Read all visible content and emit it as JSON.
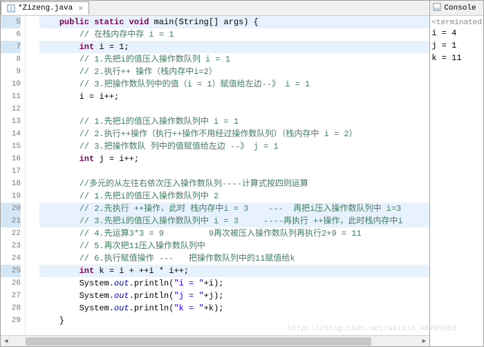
{
  "tab": {
    "title": "*Zizeng.java"
  },
  "console": {
    "label": "Console",
    "status": "<terminated",
    "lines": [
      "i = 4",
      "j = 1",
      "k = 11"
    ]
  },
  "lines": [
    {
      "n": 5,
      "hl": true,
      "segs": [
        {
          "t": "    ",
          "c": ""
        },
        {
          "t": "public static void",
          "c": "kw"
        },
        {
          "t": " main(String[] args) {",
          "c": ""
        }
      ]
    },
    {
      "n": 6,
      "segs": [
        {
          "t": "        ",
          "c": ""
        },
        {
          "t": "// 在栈内存中存 i = 1",
          "c": "cm"
        }
      ]
    },
    {
      "n": 7,
      "hl": true,
      "segs": [
        {
          "t": "        ",
          "c": ""
        },
        {
          "t": "int",
          "c": "kw"
        },
        {
          "t": " i = 1;",
          "c": ""
        }
      ]
    },
    {
      "n": 8,
      "segs": [
        {
          "t": "        ",
          "c": ""
        },
        {
          "t": "// 1.先把i的值压入操作数队列 i = 1",
          "c": "cm"
        }
      ]
    },
    {
      "n": 9,
      "segs": [
        {
          "t": "        ",
          "c": ""
        },
        {
          "t": "// 2.执行++ 操作（栈内存中i=2）",
          "c": "cm"
        }
      ]
    },
    {
      "n": 10,
      "segs": [
        {
          "t": "        ",
          "c": ""
        },
        {
          "t": "// 3.把操作数队列中的值（i = 1）赋值给左边--》 i = 1",
          "c": "cm"
        }
      ]
    },
    {
      "n": 11,
      "segs": [
        {
          "t": "        i = i++;",
          "c": ""
        }
      ]
    },
    {
      "n": 12,
      "segs": [
        {
          "t": "",
          "c": ""
        }
      ]
    },
    {
      "n": 13,
      "segs": [
        {
          "t": "        ",
          "c": ""
        },
        {
          "t": "// 1.先把i的值压入操作数队列中 i = 1",
          "c": "cm"
        }
      ]
    },
    {
      "n": 14,
      "segs": [
        {
          "t": "        ",
          "c": ""
        },
        {
          "t": "// 2.执行++操作（执行++操作不用经过操作数队列）（栈内存中 i = 2）",
          "c": "cm"
        }
      ]
    },
    {
      "n": 15,
      "segs": [
        {
          "t": "        ",
          "c": ""
        },
        {
          "t": "// 3.把操作数队 列中的值赋值给左边 --》 j = 1",
          "c": "cm"
        }
      ]
    },
    {
      "n": 16,
      "segs": [
        {
          "t": "        ",
          "c": ""
        },
        {
          "t": "int",
          "c": "kw"
        },
        {
          "t": " j = i++;",
          "c": ""
        }
      ]
    },
    {
      "n": 17,
      "segs": [
        {
          "t": "",
          "c": ""
        }
      ]
    },
    {
      "n": 18,
      "segs": [
        {
          "t": "        ",
          "c": ""
        },
        {
          "t": "//多元的从左往右依次压入操作数队列----计算式按四则运算",
          "c": "cm"
        }
      ]
    },
    {
      "n": 19,
      "segs": [
        {
          "t": "        ",
          "c": ""
        },
        {
          "t": "// 1.先把i的值压入操作数队列中 2",
          "c": "cm"
        }
      ]
    },
    {
      "n": 20,
      "hl": true,
      "segs": [
        {
          "t": "        ",
          "c": ""
        },
        {
          "t": "// 2.先执行 ++操作，此时 栈内存中i = 3    ---  再把i压入操作数队列中 i=3",
          "c": "cm"
        }
      ]
    },
    {
      "n": 21,
      "hl": true,
      "segs": [
        {
          "t": "        ",
          "c": ""
        },
        {
          "t": "// 3.先把i的值压入操作数队列中 i = 3     ----再执行 ++操作，此时栈内存中i",
          "c": "cm"
        }
      ]
    },
    {
      "n": 22,
      "segs": [
        {
          "t": "        ",
          "c": ""
        },
        {
          "t": "// 4.先运算3*3 = 9         9再次被压入操作数队列再执行2+9 = 11",
          "c": "cm"
        }
      ]
    },
    {
      "n": 23,
      "segs": [
        {
          "t": "        ",
          "c": ""
        },
        {
          "t": "// 5.再次把11压入操作数队列中",
          "c": "cm"
        }
      ]
    },
    {
      "n": 24,
      "segs": [
        {
          "t": "        ",
          "c": ""
        },
        {
          "t": "// 6.执行赋值操作 ---   把操作数队列中的11赋值给k",
          "c": "cm"
        }
      ]
    },
    {
      "n": 25,
      "hl": true,
      "segs": [
        {
          "t": "        ",
          "c": ""
        },
        {
          "t": "int",
          "c": "kw"
        },
        {
          "t": " k = i + ++i * i++;",
          "c": ""
        }
      ]
    },
    {
      "n": 26,
      "segs": [
        {
          "t": "        System.",
          "c": ""
        },
        {
          "t": "out",
          "c": "fld"
        },
        {
          "t": ".println(",
          "c": ""
        },
        {
          "t": "\"i = \"",
          "c": "str"
        },
        {
          "t": "+i);",
          "c": ""
        }
      ]
    },
    {
      "n": 27,
      "segs": [
        {
          "t": "        System.",
          "c": ""
        },
        {
          "t": "out",
          "c": "fld"
        },
        {
          "t": ".println(",
          "c": ""
        },
        {
          "t": "\"j = \"",
          "c": "str"
        },
        {
          "t": "+j);",
          "c": ""
        }
      ]
    },
    {
      "n": 28,
      "segs": [
        {
          "t": "        System.",
          "c": ""
        },
        {
          "t": "out",
          "c": "fld"
        },
        {
          "t": ".println(",
          "c": ""
        },
        {
          "t": "\"k = \"",
          "c": "str"
        },
        {
          "t": "+k);",
          "c": ""
        }
      ]
    },
    {
      "n": 29,
      "segs": [
        {
          "t": "    }",
          "c": ""
        }
      ]
    }
  ],
  "watermark": "https://blog.csdn.net/weixin_46705983"
}
